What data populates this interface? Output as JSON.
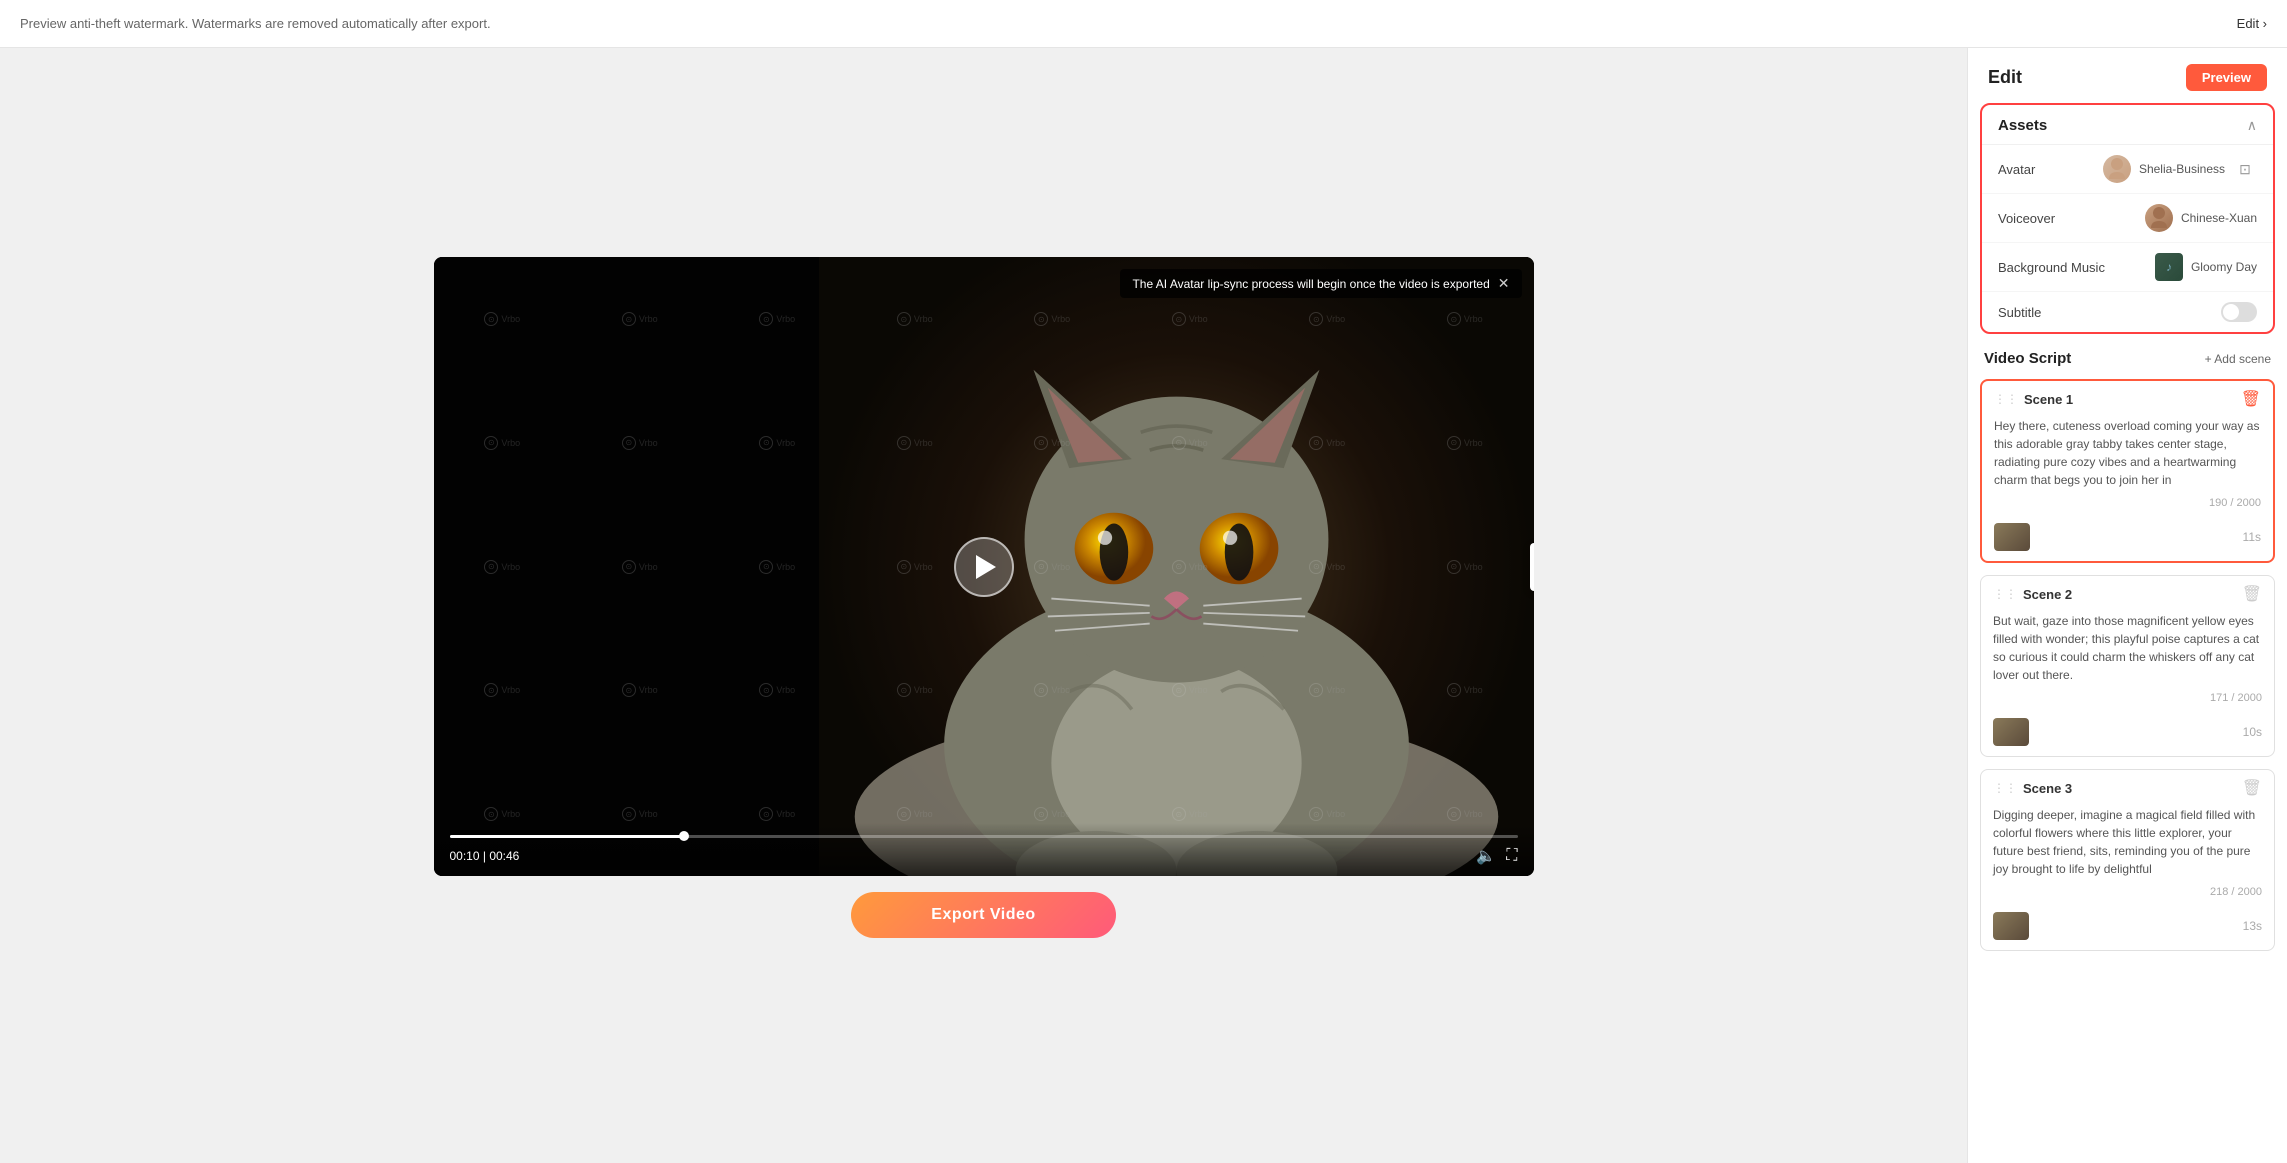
{
  "topbar": {
    "watermark_notice": "Preview anti-theft watermark. Watermarks are removed automatically after export.",
    "edit_link": "Edit ›"
  },
  "video": {
    "notification": "The AI Avatar lip-sync process will begin once the video is exported",
    "time_current": "00:10",
    "time_total": "00:46",
    "play_label": "Play",
    "progress_percent": 22
  },
  "export": {
    "button_label": "Export Video"
  },
  "rightPanel": {
    "title": "Edit",
    "preview_button": "Preview",
    "assets": {
      "section_title": "Assets",
      "avatar": {
        "label": "Avatar",
        "name": "Shelia-Business"
      },
      "voiceover": {
        "label": "Voiceover",
        "name": "Chinese-Xuan"
      },
      "background_music": {
        "label": "Background Music",
        "name": "Gloomy Day"
      },
      "subtitle": {
        "label": "Subtitle",
        "enabled": false
      }
    },
    "video_script": {
      "title": "Video Script",
      "add_scene": "+ Add scene",
      "scenes": [
        {
          "id": 1,
          "label": "Scene 1",
          "text": "Hey there, cuteness overload coming your way as this adorable gray tabby takes center stage, radiating pure cozy vibes and a heartwarming charm that begs you to join her in",
          "char_count": "190 / 2000",
          "duration": "11s",
          "active": true
        },
        {
          "id": 2,
          "label": "Scene 2",
          "text": "But wait, gaze into those magnificent yellow eyes filled with wonder; this playful poise captures a cat so curious it could charm the whiskers off any cat lover out there.",
          "char_count": "171 / 2000",
          "duration": "10s",
          "active": false
        },
        {
          "id": 3,
          "label": "Scene 3",
          "text": "Digging deeper, imagine a magical field filled with colorful flowers where this little explorer, your future best friend, sits, reminding you of the pure joy brought to life by delightful",
          "char_count": "218 / 2000",
          "duration": "13s",
          "active": false
        }
      ]
    }
  },
  "watermark": {
    "text": "Vrbo"
  }
}
